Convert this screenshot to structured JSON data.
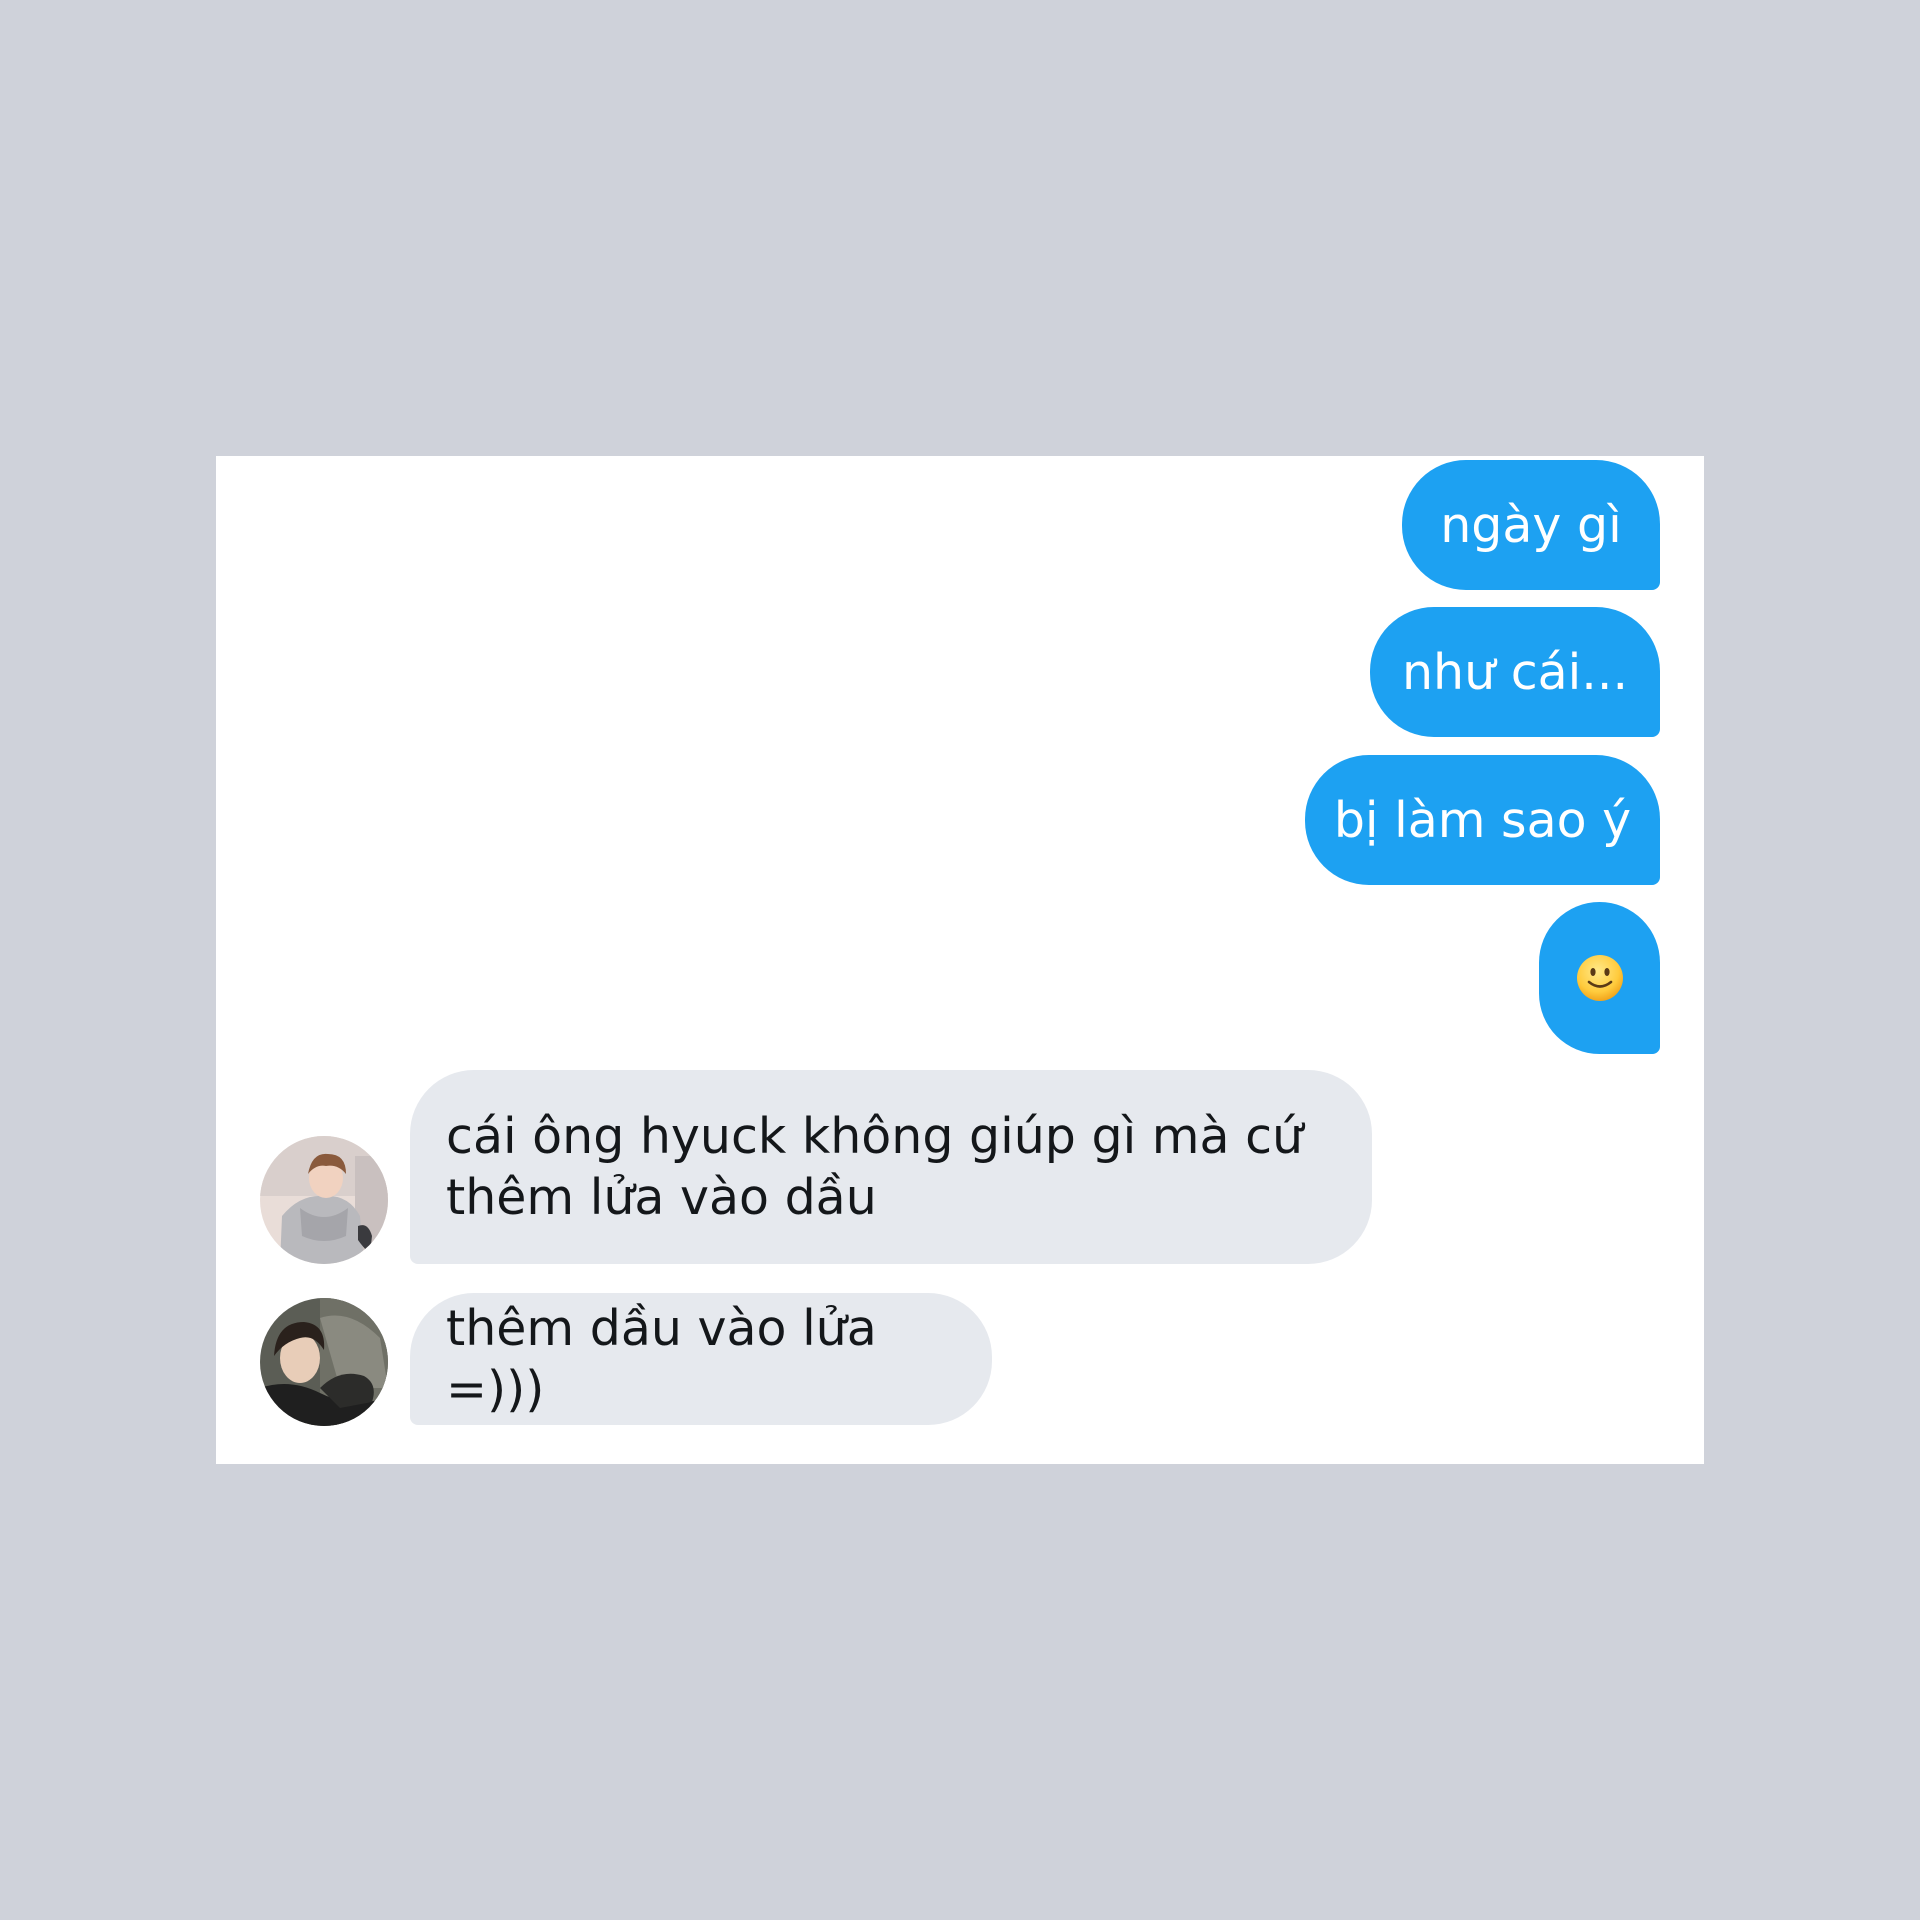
{
  "conversation": {
    "sent_messages": [
      {
        "text": "ngày gì"
      },
      {
        "text": "như cái..."
      },
      {
        "text": "bị làm sao ý"
      },
      {
        "emoji": "slightly-smiling-face-icon"
      }
    ],
    "received_messages": [
      {
        "text": "cái ông hyuck không giúp gì mà cứ thêm lửa vào dầu",
        "avatar": "avatar-photo-1"
      },
      {
        "text": "thêm dầu vào lửa =)))",
        "avatar": "avatar-photo-2"
      }
    ]
  },
  "colors": {
    "page_background": "#cfd2da",
    "card_background": "#ffffff",
    "sent_bubble": "#1da1f2",
    "received_bubble": "#e6e9ee",
    "received_text": "#14171a"
  }
}
